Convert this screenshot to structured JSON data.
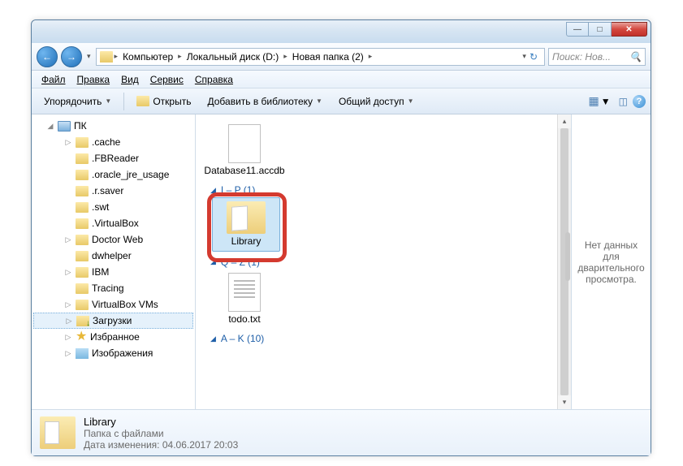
{
  "titlebar": {
    "minimize": "—",
    "maximize": "□",
    "close": "✕"
  },
  "nav": {
    "back": "←",
    "forward": "→",
    "dropdown": "▾",
    "refresh": "↻"
  },
  "breadcrumbs": [
    {
      "label": "Компьютер"
    },
    {
      "label": "Локальный диск (D:)"
    },
    {
      "label": "Новая папка (2)"
    }
  ],
  "search": {
    "placeholder": "Поиск: Нов..."
  },
  "menu": {
    "file": "Файл",
    "edit": "Правка",
    "view": "Вид",
    "tools": "Сервис",
    "help": "Справка"
  },
  "toolbar": {
    "organize": "Упорядочить",
    "open": "Открыть",
    "library": "Добавить в библиотеку",
    "share": "Общий доступ"
  },
  "tree": {
    "root": "ПК",
    "items": [
      ".cache",
      ".FBReader",
      ".oracle_jre_usage",
      ".r.saver",
      ".swt",
      ".VirtualBox",
      "Doctor Web",
      "dwhelper",
      "IBM",
      "Tracing",
      "VirtualBox VMs",
      "Загрузки",
      "Избранное",
      "Изображения"
    ]
  },
  "content": {
    "file1": "Database11.accdb",
    "group1": "I – P (1)",
    "folder1": "Library",
    "group2": "Q – Z (1)",
    "file2": "todo.txt",
    "group3": "A – K (10)"
  },
  "preview": {
    "empty": "Нет данных для дварительного просмотра."
  },
  "details": {
    "name": "Library",
    "type": "Папка с файлами",
    "date_label": "Дата изменения:",
    "date_value": "04.06.2017 20:03"
  }
}
